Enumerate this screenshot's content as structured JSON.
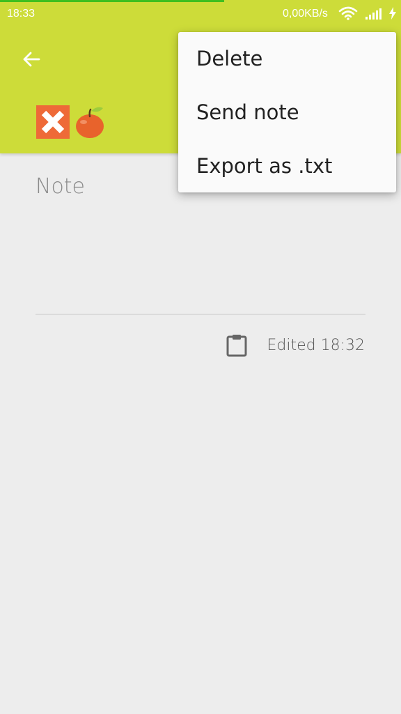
{
  "status_bar": {
    "time": "18:33",
    "network_speed": "0,00KB/s",
    "icons": [
      "wifi-icon",
      "signal-icon",
      "battery-charging-icon"
    ]
  },
  "colors": {
    "app_bar": "#cddc39",
    "progress": "#3fbf1f",
    "background": "#ededed",
    "menu_background": "#fafafa"
  },
  "app_bar": {
    "back_icon": "arrow-left-icon",
    "title_emojis": [
      "cross-mark-icon",
      "apple-icon"
    ]
  },
  "note": {
    "placeholder": "Note",
    "edited_label": "Edited 18:32",
    "copy_icon": "clipboard-icon"
  },
  "menu": {
    "items": [
      {
        "label": "Delete"
      },
      {
        "label": "Send note"
      },
      {
        "label": "Export as .txt"
      }
    ]
  }
}
